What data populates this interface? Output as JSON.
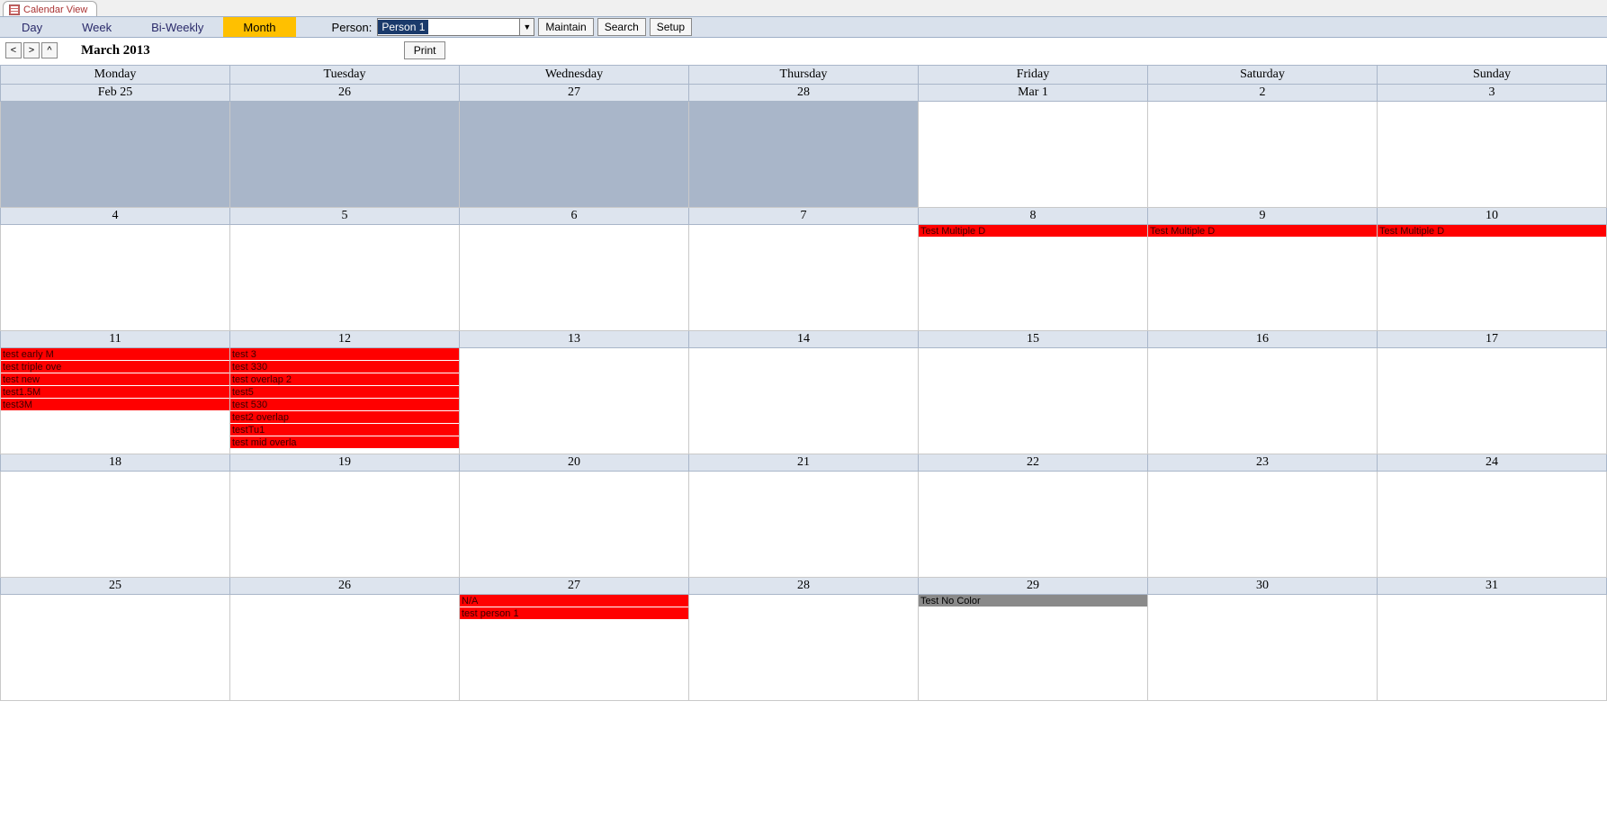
{
  "tab": {
    "title": "Calendar View"
  },
  "toolbar": {
    "views": [
      "Day",
      "Week",
      "Bi-Weekly",
      "Month"
    ],
    "active_view_index": 3,
    "person_label": "Person:",
    "person_selected": "Person 1",
    "buttons": {
      "maintain": "Maintain",
      "search": "Search",
      "setup": "Setup"
    }
  },
  "subbar": {
    "prev": "<",
    "next": ">",
    "up": "^",
    "title": "March 2013",
    "print": "Print"
  },
  "day_headers": [
    "Monday",
    "Tuesday",
    "Wednesday",
    "Thursday",
    "Friday",
    "Saturday",
    "Sunday"
  ],
  "weeks": [
    {
      "dates": [
        "Feb 25",
        "26",
        "27",
        "28",
        "Mar 1",
        "2",
        "3"
      ],
      "cells": [
        {
          "prev": true,
          "events": []
        },
        {
          "prev": true,
          "events": []
        },
        {
          "prev": true,
          "events": []
        },
        {
          "prev": true,
          "events": []
        },
        {
          "events": []
        },
        {
          "events": []
        },
        {
          "events": []
        }
      ]
    },
    {
      "dates": [
        "4",
        "5",
        "6",
        "7",
        "8",
        "9",
        "10"
      ],
      "cells": [
        {
          "events": []
        },
        {
          "events": []
        },
        {
          "events": []
        },
        {
          "events": []
        },
        {
          "events": [
            {
              "label": "Test Multiple D",
              "color": "red"
            }
          ]
        },
        {
          "events": [
            {
              "label": "Test Multiple D",
              "color": "red"
            }
          ]
        },
        {
          "events": [
            {
              "label": "Test Multiple D",
              "color": "red"
            }
          ]
        }
      ]
    },
    {
      "dates": [
        "11",
        "12",
        "13",
        "14",
        "15",
        "16",
        "17"
      ],
      "cells": [
        {
          "events": [
            {
              "label": "test early M",
              "color": "red"
            },
            {
              "label": "test triple ove",
              "color": "red"
            },
            {
              "label": "test new",
              "color": "red"
            },
            {
              "label": "test1.5M",
              "color": "red"
            },
            {
              "label": "test3M",
              "color": "red"
            }
          ]
        },
        {
          "events": [
            {
              "label": "test 3",
              "color": "red"
            },
            {
              "label": "test 330",
              "color": "red"
            },
            {
              "label": "test overlap 2",
              "color": "red"
            },
            {
              "label": "test5",
              "color": "red"
            },
            {
              "label": "test 530",
              "color": "red"
            },
            {
              "label": "test2 overlap",
              "color": "red"
            },
            {
              "label": "testTu1",
              "color": "red"
            },
            {
              "label": "test mid overla",
              "color": "red"
            }
          ]
        },
        {
          "events": []
        },
        {
          "events": []
        },
        {
          "events": []
        },
        {
          "events": []
        },
        {
          "events": []
        }
      ]
    },
    {
      "dates": [
        "18",
        "19",
        "20",
        "21",
        "22",
        "23",
        "24"
      ],
      "cells": [
        {
          "events": []
        },
        {
          "events": []
        },
        {
          "events": []
        },
        {
          "events": []
        },
        {
          "events": []
        },
        {
          "events": []
        },
        {
          "events": []
        }
      ]
    },
    {
      "dates": [
        "25",
        "26",
        "27",
        "28",
        "29",
        "30",
        "31"
      ],
      "cells": [
        {
          "events": []
        },
        {
          "events": []
        },
        {
          "events": [
            {
              "label": "N/A",
              "color": "red"
            },
            {
              "label": "test person 1",
              "color": "red"
            }
          ]
        },
        {
          "events": []
        },
        {
          "events": [
            {
              "label": "Test No Color",
              "color": "gray"
            }
          ]
        },
        {
          "events": []
        },
        {
          "events": []
        }
      ]
    }
  ]
}
